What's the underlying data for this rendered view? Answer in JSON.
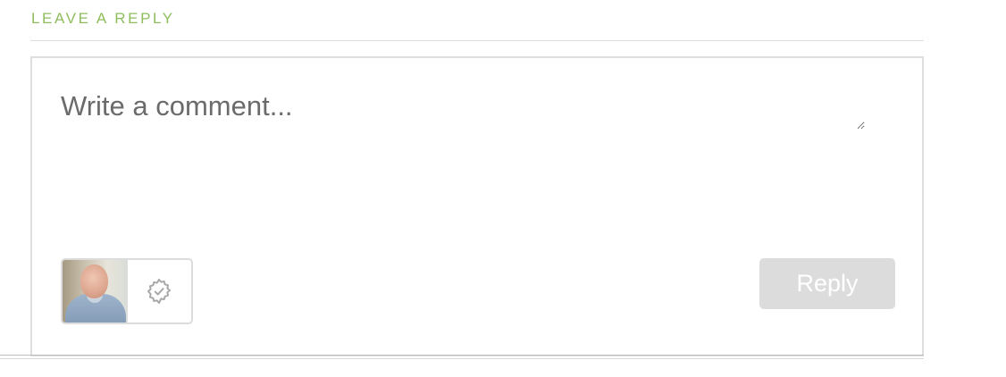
{
  "reply_section": {
    "title": "Leave a Reply",
    "comment_placeholder": "Write a comment...",
    "comment_value": "",
    "reply_label": "Reply"
  },
  "icons": {
    "avatar": "user-avatar",
    "settings": "gear-icon"
  },
  "colors": {
    "title": "#8fbd5e",
    "reply_button_bg": "#dcdcdd",
    "reply_button_text": "#ffffff",
    "border": "#dedede"
  }
}
